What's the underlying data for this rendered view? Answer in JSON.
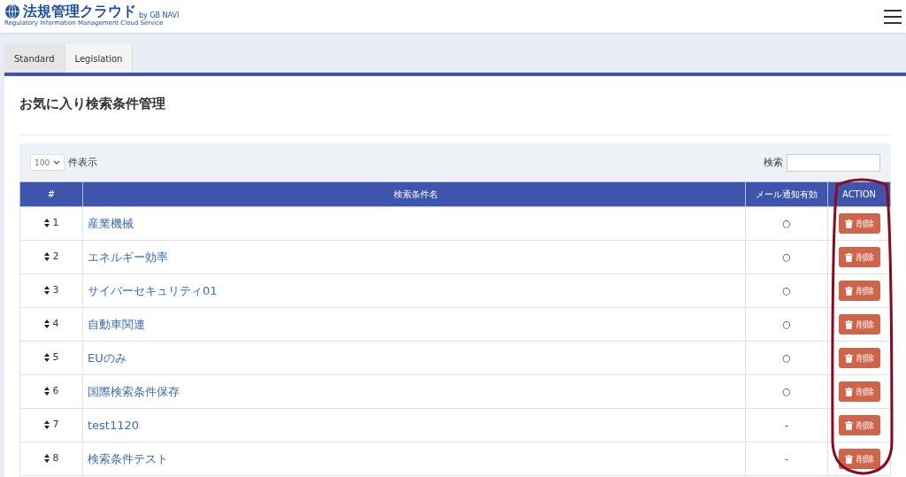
{
  "header": {
    "logo_title": "法規管理クラウド",
    "logo_by": "by GB NAVI",
    "logo_subtitle": "Regulatory Information Management Cloud Service"
  },
  "tabs": [
    {
      "label": "Standard",
      "selected": true
    },
    {
      "label": "Legislation",
      "selected": false
    }
  ],
  "page_title": "お気に入り検索条件管理",
  "toolbar": {
    "page_size": "100",
    "page_size_label": "件表示",
    "search_label": "検索"
  },
  "table": {
    "columns": [
      "#",
      "検索条件名",
      "メール通知有効",
      "ACTION"
    ],
    "rows": [
      {
        "no": "1",
        "name": "産業機械",
        "mail": "○",
        "action": "削除"
      },
      {
        "no": "2",
        "name": "エネルギー効率",
        "mail": "○",
        "action": "削除"
      },
      {
        "no": "3",
        "name": "サイバーセキュリティ01",
        "mail": "○",
        "action": "削除"
      },
      {
        "no": "4",
        "name": "自動車関連",
        "mail": "○",
        "action": "削除"
      },
      {
        "no": "5",
        "name": "EUのみ",
        "mail": "○",
        "action": "削除"
      },
      {
        "no": "6",
        "name": "国際検索条件保存",
        "mail": "○",
        "action": "削除"
      },
      {
        "no": "7",
        "name": "test1120",
        "mail": "-",
        "action": "削除"
      },
      {
        "no": "8",
        "name": "検索条件テスト",
        "mail": "-",
        "action": "削除"
      }
    ]
  }
}
